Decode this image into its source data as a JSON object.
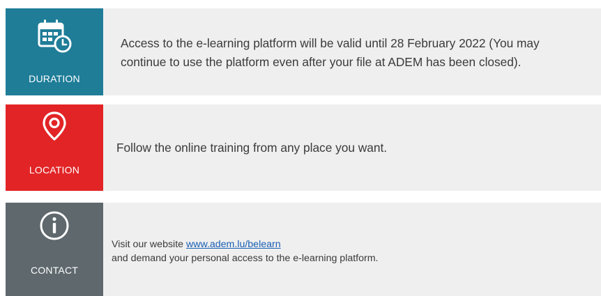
{
  "items": [
    {
      "label": "DURATION",
      "icon": "calendar-clock-icon",
      "text": "Access to the e-learning platform will be valid until 28 February 2022 (You may continue to use the platform even after your file at ADEM has been closed).",
      "color": "#1f7d98"
    },
    {
      "label": "LOCATION",
      "icon": "location-pin-icon",
      "text": "Follow the online training from any place you want.",
      "color": "#e22426"
    },
    {
      "label": "CONTACT",
      "icon": "info-icon",
      "text_before_link": "Visit our website ",
      "link_text": "www.adem.lu/belearn",
      "text_after_link": "and demand your personal access to the e-learning platform.",
      "color": "#5e686d"
    }
  ],
  "colors": {
    "row_background": "#efefef",
    "body_text": "#3a3a3a",
    "link": "#1a5fb4"
  }
}
